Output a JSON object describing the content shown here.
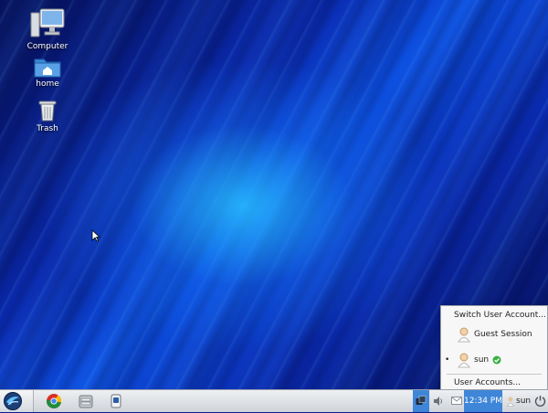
{
  "desktop": {
    "icons": [
      {
        "label": "Computer",
        "icon": "computer-icon"
      },
      {
        "label": "home",
        "icon": "home-folder-icon"
      },
      {
        "label": "Trash",
        "icon": "trash-icon"
      }
    ]
  },
  "user_menu": {
    "switch_label": "Switch User Account...",
    "guest_label": "Guest Session",
    "current_user": "sun",
    "accounts_label": "User Accounts..."
  },
  "taskbar": {
    "clock": "12:34 PM",
    "user": "sun",
    "launchers": [
      "chrome-icon",
      "file-manager-icon",
      "terminal-icon"
    ]
  },
  "colors": {
    "accent": "#3f86d8",
    "ok_check": "#3cb043"
  }
}
